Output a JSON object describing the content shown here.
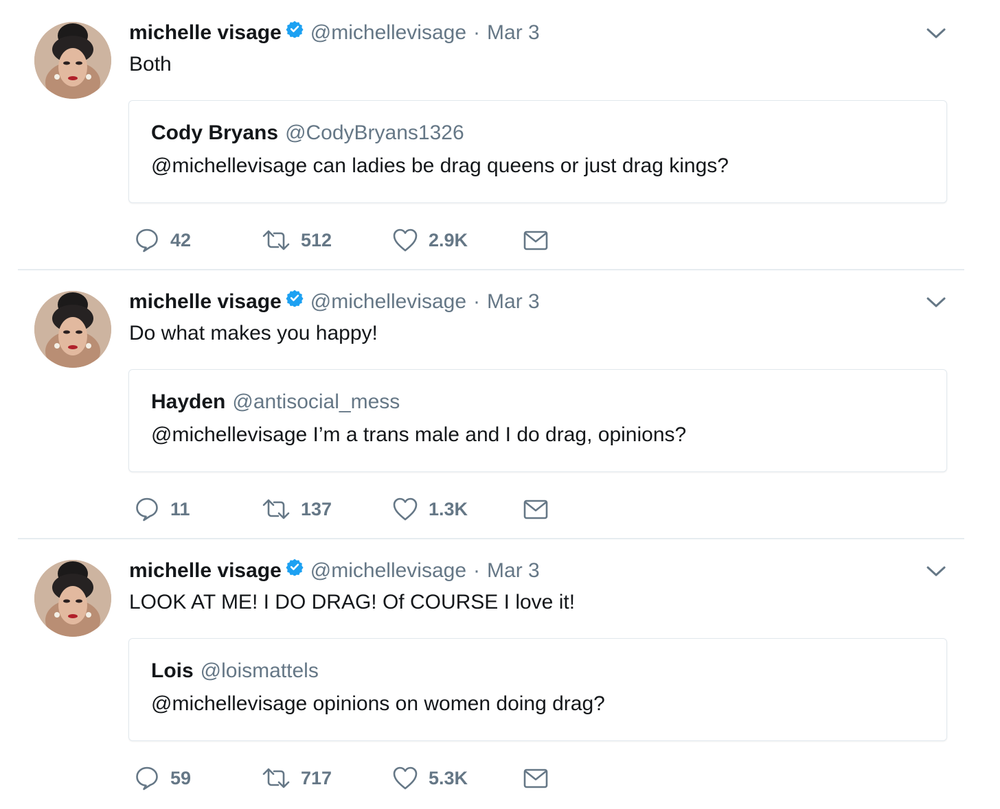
{
  "tweets": [
    {
      "author": "michelle visage",
      "handle": "@michellevisage",
      "separator": "·",
      "date": "Mar 3",
      "text": "Both",
      "quote": {
        "author": "Cody Bryans",
        "handle": "@CodyBryans1326",
        "text": "@michellevisage can ladies be drag queens or just drag kings?"
      },
      "replies": "42",
      "retweets": "512",
      "likes": "2.9K"
    },
    {
      "author": "michelle visage",
      "handle": "@michellevisage",
      "separator": "·",
      "date": "Mar 3",
      "text": "Do what makes you happy!",
      "quote": {
        "author": "Hayden",
        "handle": "@antisocial_mess",
        "text": "@michellevisage I’m a trans male and I do drag, opinions?"
      },
      "replies": "11",
      "retweets": "137",
      "likes": "1.3K"
    },
    {
      "author": "michelle visage",
      "handle": "@michellevisage",
      "separator": "·",
      "date": "Mar 3",
      "text": "LOOK AT ME! I DO DRAG! Of COURSE I love it!",
      "quote": {
        "author": "Lois",
        "handle": "@loismattels",
        "text": "@michellevisage opinions on women doing drag?"
      },
      "replies": "59",
      "retweets": "717",
      "likes": "5.3K"
    }
  ],
  "icons": {
    "verified": "verified-badge-icon",
    "chevron": "chevron-down-icon",
    "reply": "reply-bubble-icon",
    "retweet": "retweet-icon",
    "like": "heart-icon",
    "dm": "envelope-icon"
  },
  "colors": {
    "verified_blue": "#1da1f2",
    "secondary_text": "#657786",
    "primary_text": "#14171a",
    "border": "#e1e8ed"
  }
}
